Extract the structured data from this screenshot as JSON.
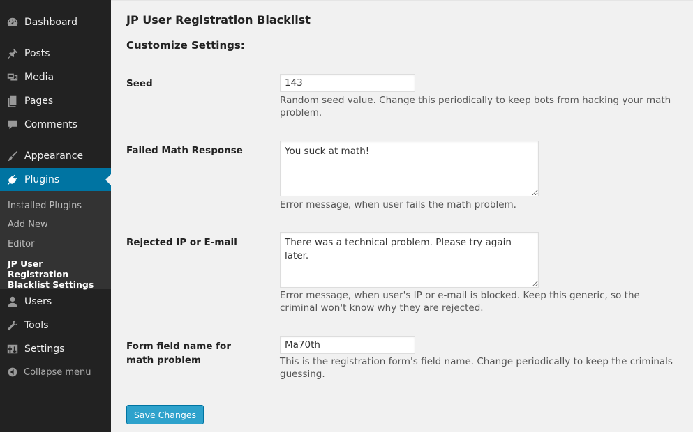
{
  "sidebar": {
    "items": [
      {
        "label": "Dashboard",
        "icon": "dashboard-icon"
      },
      {
        "label": "Posts",
        "icon": "pin-icon"
      },
      {
        "label": "Media",
        "icon": "media-icon"
      },
      {
        "label": "Pages",
        "icon": "pages-icon"
      },
      {
        "label": "Comments",
        "icon": "comment-icon"
      },
      {
        "label": "Appearance",
        "icon": "brush-icon"
      },
      {
        "label": "Plugins",
        "icon": "plug-icon",
        "current": true
      },
      {
        "label": "Users",
        "icon": "user-icon"
      },
      {
        "label": "Tools",
        "icon": "wrench-icon"
      },
      {
        "label": "Settings",
        "icon": "settings-icon"
      }
    ],
    "submenu": [
      {
        "label": "Installed Plugins"
      },
      {
        "label": "Add New"
      },
      {
        "label": "Editor"
      },
      {
        "label": "JP User Registration Blacklist Settings",
        "current": true
      }
    ],
    "collapse_label": "Collapse menu"
  },
  "main": {
    "page_title": "JP User Registration Blacklist",
    "section_title": "Customize Settings:",
    "fields": {
      "seed": {
        "label": "Seed",
        "value": "143",
        "description": "Random seed value. Change this periodically to keep bots from hacking your math problem."
      },
      "failed_math": {
        "label": "Failed Math Response",
        "value": "You suck at math!",
        "description": "Error message, when user fails the math problem."
      },
      "rejected": {
        "label": "Rejected IP or E-mail",
        "value": "There was a technical problem. Please try again later.",
        "description": "Error message, when user's IP or e-mail is blocked. Keep this generic, so the criminal won't know why they are rejected."
      },
      "field_name": {
        "label": "Form field name for math problem",
        "value": "Ma70th",
        "description": "This is the registration form's field name. Change periodically to keep the criminals guessing."
      }
    },
    "save_label": "Save Changes"
  },
  "colors": {
    "sidebar_bg": "#222222",
    "submenu_bg": "#333333",
    "accent": "#0074a2",
    "button": "#2ea2cc",
    "content_bg": "#f1f1f1"
  }
}
